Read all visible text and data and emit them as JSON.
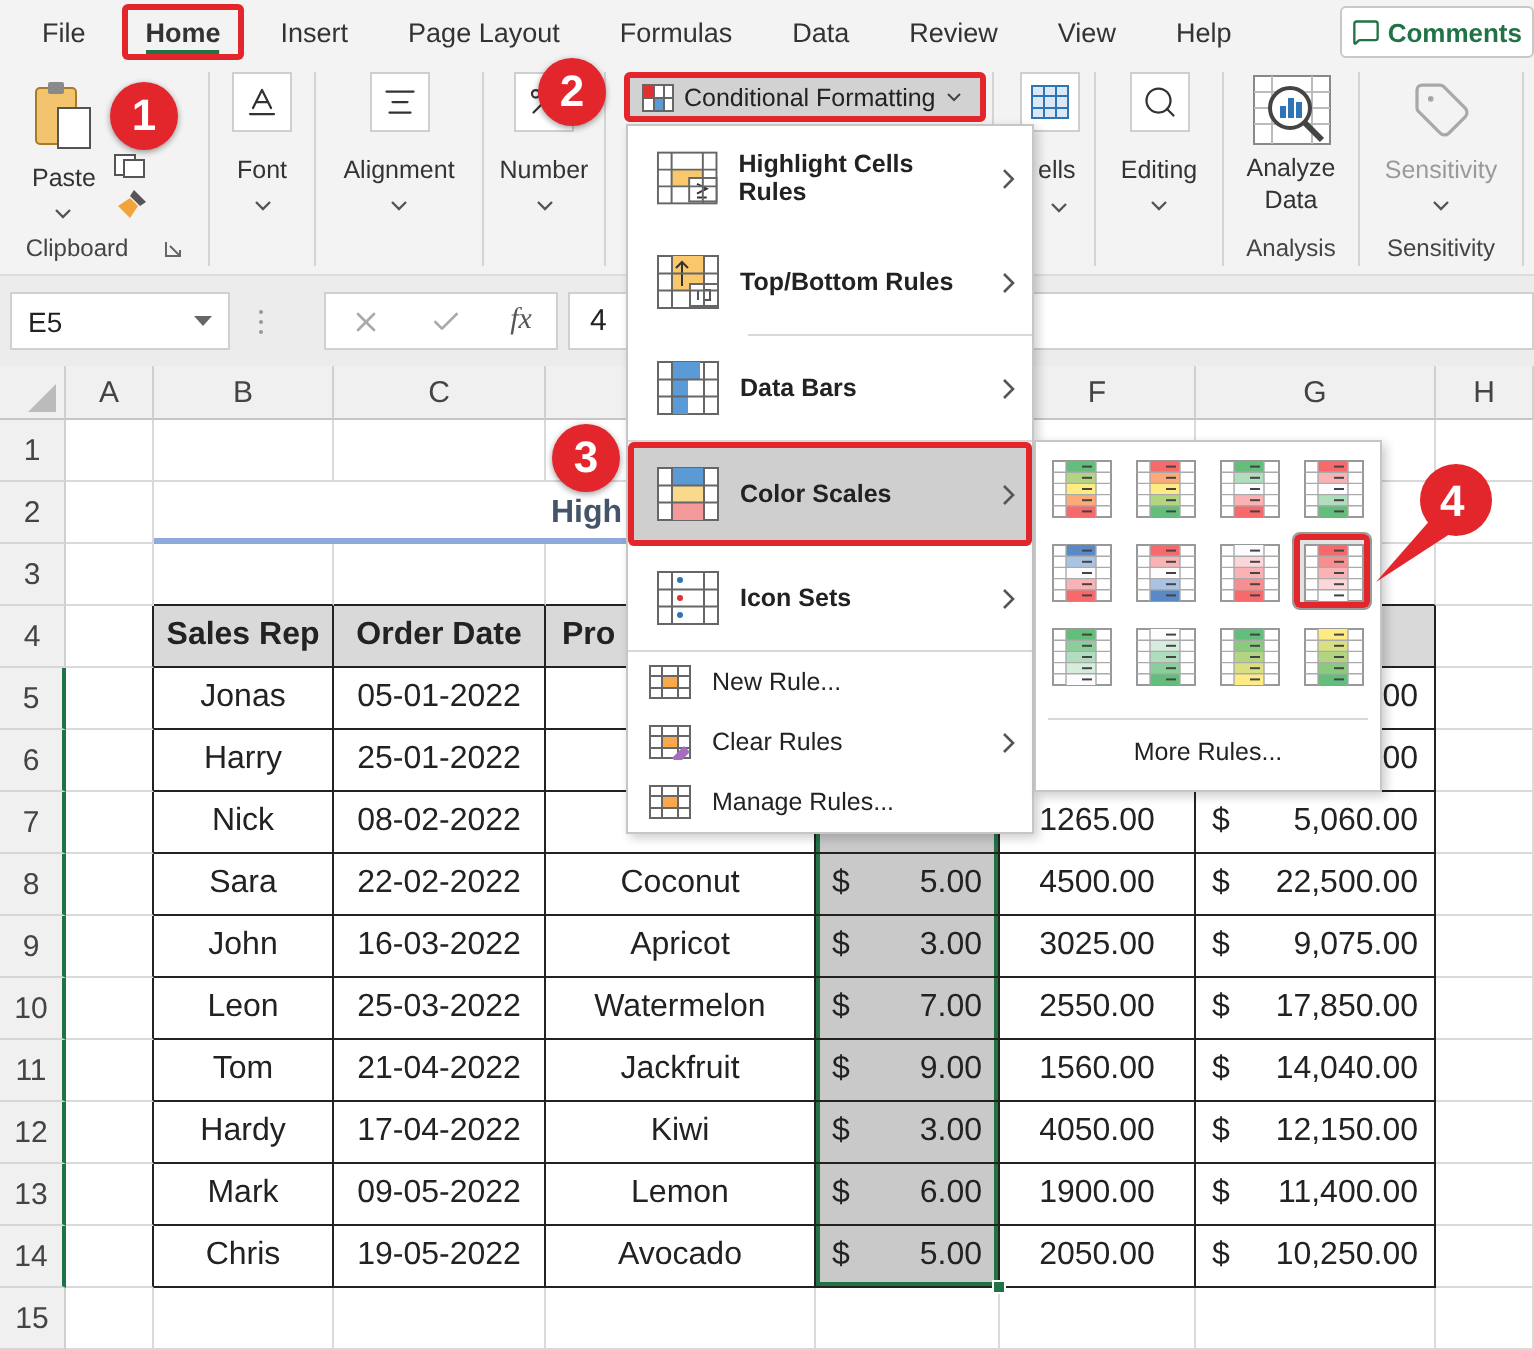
{
  "menu_tabs": [
    {
      "label": "File",
      "selected": false,
      "marked": false
    },
    {
      "label": "Home",
      "selected": true,
      "marked": true
    },
    {
      "label": "Insert",
      "selected": false,
      "marked": false
    },
    {
      "label": "Page Layout",
      "selected": false,
      "marked": false
    },
    {
      "label": "Formulas",
      "selected": false,
      "marked": false
    },
    {
      "label": "Data",
      "selected": false,
      "marked": false
    },
    {
      "label": "Review",
      "selected": false,
      "marked": false
    },
    {
      "label": "View",
      "selected": false,
      "marked": false
    },
    {
      "label": "Help",
      "selected": false,
      "marked": false
    }
  ],
  "comments_button": "Comments",
  "ribbon": {
    "groups": [
      {
        "kind": "clipboard",
        "label": "Paste",
        "caption": "Clipboard"
      },
      {
        "kind": "font",
        "label": "Font"
      },
      {
        "kind": "alignment",
        "label": "Alignment"
      },
      {
        "kind": "number",
        "label": "Number"
      },
      {
        "kind": "conditional",
        "label": "Conditional Formatting",
        "marked": true,
        "expanded": true
      },
      {
        "kind": "cells",
        "label": "ells"
      },
      {
        "kind": "editing",
        "label": "Editing"
      },
      {
        "kind": "analysis",
        "label": "Analyze Data",
        "caption": "Analysis"
      },
      {
        "kind": "sensitivity",
        "label": "Sensitivity",
        "caption": "Sensitivity",
        "disabled": true
      }
    ]
  },
  "formula_bar": {
    "name_box": "E5",
    "function_label": "fx",
    "value": "4"
  },
  "sheet": {
    "column_letters": [
      "A",
      "B",
      "C",
      "F",
      "G",
      "H"
    ],
    "row_numbers": [
      "1",
      "2",
      "3",
      "4",
      "5",
      "6",
      "7",
      "8",
      "9",
      "10",
      "11",
      "12",
      "13",
      "14",
      "15"
    ],
    "title": "High"
  },
  "table": {
    "columns": [
      {
        "label": "Sales Rep",
        "kind": "text",
        "selected": false
      },
      {
        "label": "Order Date",
        "kind": "text",
        "selected": false
      },
      {
        "label": "Pro",
        "kind": "text",
        "selected": false
      },
      {
        "kind": "currency",
        "selected": true
      },
      {
        "kind": "text",
        "selected": false
      },
      {
        "kind": "currency",
        "selected": false
      }
    ],
    "rows": [
      {
        "rep": "Jonas",
        "date": "05-01-2022",
        "total": {
          "amount": "00"
        }
      },
      {
        "rep": "Harry",
        "date": "25-01-2022",
        "total": {
          "amount": "00"
        }
      },
      {
        "rep": "Nick",
        "date": "08-02-2022",
        "quantity": "1265.00",
        "total": {
          "sign": "$",
          "amount": "5,060.00"
        }
      },
      {
        "rep": "Sara",
        "date": "22-02-2022",
        "product": "Coconut",
        "price": {
          "sign": "$",
          "amount": "5.00"
        },
        "quantity": "4500.00",
        "total": {
          "sign": "$",
          "amount": "22,500.00"
        }
      },
      {
        "rep": "John",
        "date": "16-03-2022",
        "product": "Apricot",
        "price": {
          "sign": "$",
          "amount": "3.00"
        },
        "quantity": "3025.00",
        "total": {
          "sign": "$",
          "amount": "9,075.00"
        }
      },
      {
        "rep": "Leon",
        "date": "25-03-2022",
        "product": "Watermelon",
        "price": {
          "sign": "$",
          "amount": "7.00"
        },
        "quantity": "2550.00",
        "total": {
          "sign": "$",
          "amount": "17,850.00"
        }
      },
      {
        "rep": "Tom",
        "date": "21-04-2022",
        "product": "Jackfruit",
        "price": {
          "sign": "$",
          "amount": "9.00"
        },
        "quantity": "1560.00",
        "total": {
          "sign": "$",
          "amount": "14,040.00"
        }
      },
      {
        "rep": "Hardy",
        "date": "17-04-2022",
        "product": "Kiwi",
        "price": {
          "sign": "$",
          "amount": "3.00"
        },
        "quantity": "4050.00",
        "total": {
          "sign": "$",
          "amount": "12,150.00"
        }
      },
      {
        "rep": "Mark",
        "date": "09-05-2022",
        "product": "Lemon",
        "price": {
          "sign": "$",
          "amount": "6.00"
        },
        "quantity": "1900.00",
        "total": {
          "sign": "$",
          "amount": "11,400.00"
        }
      },
      {
        "rep": "Chris",
        "date": "19-05-2022",
        "product": "Avocado",
        "price": {
          "sign": "$",
          "amount": "5.00"
        },
        "quantity": "2050.00",
        "total": {
          "sign": "$",
          "amount": "10,250.00"
        }
      }
    ]
  },
  "cf_menu": {
    "items": [
      {
        "kind": "large",
        "label": "Highlight Cells Rules",
        "submenu": true,
        "selected": false,
        "marked": false
      },
      {
        "kind": "large",
        "label": "Top/Bottom Rules",
        "submenu": true,
        "selected": false,
        "marked": false
      },
      {
        "kind": "large",
        "label": "Data Bars",
        "submenu": true,
        "selected": false,
        "marked": false
      },
      {
        "kind": "large",
        "label": "Color Scales",
        "submenu": true,
        "selected": true,
        "marked": true
      },
      {
        "kind": "large",
        "label": "Icon Sets",
        "submenu": true,
        "selected": false,
        "marked": false
      },
      {
        "kind": "small",
        "label": "New Rule...",
        "submenu": false,
        "selected": false,
        "marked": false
      },
      {
        "kind": "small",
        "label": "Clear Rules",
        "submenu": true,
        "selected": false,
        "marked": false
      },
      {
        "kind": "small",
        "label": "Manage Rules...",
        "submenu": false,
        "selected": false,
        "marked": false
      }
    ]
  },
  "color_scales": {
    "swatches": [
      {
        "bands": [
          {
            "color": "#63be7b"
          },
          {
            "color": "#ffeb84"
          },
          {
            "color": "#f8696b"
          }
        ],
        "selected": false,
        "marked": false
      },
      {
        "bands": [
          {
            "color": "#f8696b"
          },
          {
            "color": "#ffeb84"
          },
          {
            "color": "#63be7b"
          }
        ],
        "selected": false,
        "marked": false
      },
      {
        "bands": [
          {
            "color": "#63be7b"
          },
          {
            "color": "#fcfcff"
          },
          {
            "color": "#f8696b"
          }
        ],
        "selected": false,
        "marked": false
      },
      {
        "bands": [
          {
            "color": "#f8696b"
          },
          {
            "color": "#fcfcff"
          },
          {
            "color": "#63be7b"
          }
        ],
        "selected": false,
        "marked": false
      },
      {
        "bands": [
          {
            "color": "#5a8ac6"
          },
          {
            "color": "#fcfcff"
          },
          {
            "color": "#f8696b"
          }
        ],
        "selected": false,
        "marked": false
      },
      {
        "bands": [
          {
            "color": "#f8696b"
          },
          {
            "color": "#fcfcff"
          },
          {
            "color": "#5a8ac6"
          }
        ],
        "selected": false,
        "marked": false
      },
      {
        "bands": [
          {
            "color": "#fcfcff"
          },
          {
            "color": "#fab2b5"
          },
          {
            "color": "#f8696b"
          }
        ],
        "selected": false,
        "marked": false
      },
      {
        "bands": [
          {
            "color": "#f8696b"
          },
          {
            "color": "#fab2b5"
          },
          {
            "color": "#fcfcff"
          }
        ],
        "selected": true,
        "marked": true
      },
      {
        "bands": [
          {
            "color": "#63be7b"
          },
          {
            "color": "#b0ddbd"
          },
          {
            "color": "#fcfcff"
          }
        ],
        "selected": false,
        "marked": false
      },
      {
        "bands": [
          {
            "color": "#fcfcff"
          },
          {
            "color": "#b0ddbd"
          },
          {
            "color": "#63be7b"
          }
        ],
        "selected": false,
        "marked": false
      },
      {
        "bands": [
          {
            "color": "#63be7b"
          },
          {
            "color": "#b1d580"
          },
          {
            "color": "#ffeb84"
          }
        ],
        "selected": false,
        "marked": false
      },
      {
        "bands": [
          {
            "color": "#ffeb84"
          },
          {
            "color": "#b1d580"
          },
          {
            "color": "#63be7b"
          }
        ],
        "selected": false,
        "marked": false
      }
    ],
    "more_rules": "More Rules..."
  },
  "callouts": [
    "1",
    "2",
    "3",
    "4"
  ]
}
